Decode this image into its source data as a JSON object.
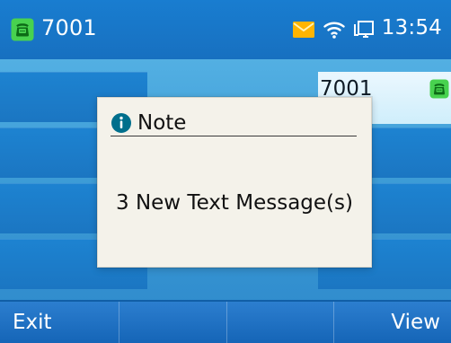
{
  "status_bar": {
    "line_number": "7001",
    "time": "13:54",
    "icons": {
      "phone": "phone-icon",
      "message": "envelope-icon",
      "wifi": "wifi-icon",
      "display": "display-icon"
    }
  },
  "account_chip": {
    "label": "7001"
  },
  "dialog": {
    "title": "Note",
    "message": "3 New Text Message(s)",
    "icon": "info-icon"
  },
  "softkeys": [
    {
      "label": "Exit"
    },
    {
      "label": ""
    },
    {
      "label": ""
    },
    {
      "label": "View"
    }
  ],
  "colors": {
    "status_bar": "#197dd0",
    "background": "#48a8df",
    "line_key": "#1b7cc9",
    "dialog_bg": "#f4f2ea",
    "phone_green": "#48d24f",
    "message_orange": "#ffb400",
    "info_teal": "#006f8c"
  }
}
